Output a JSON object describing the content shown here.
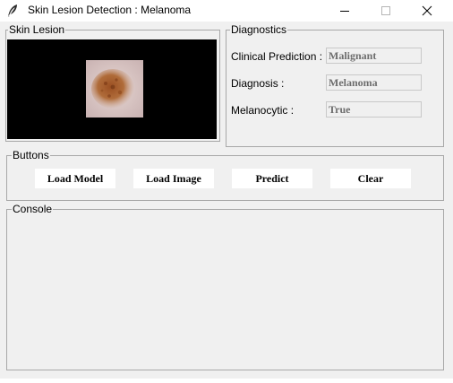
{
  "window": {
    "title": "Skin Lesion Detection : Melanoma",
    "icons": {
      "app": "feather-icon",
      "minimize": "minimize-icon",
      "maximize": "maximize-icon",
      "close": "close-icon"
    }
  },
  "skin_lesion": {
    "legend": "Skin Lesion",
    "image_icon": "skin-lesion-photo"
  },
  "diagnostics": {
    "legend": "Diagnostics",
    "fields": [
      {
        "label": "Clinical Prediction :",
        "value": "Malignant"
      },
      {
        "label": "Diagnosis :",
        "value": "Melanoma"
      },
      {
        "label": "Melanocytic :",
        "value": "True"
      }
    ]
  },
  "buttons": {
    "legend": "Buttons",
    "items": [
      {
        "label": "Load Model"
      },
      {
        "label": "Load Image"
      },
      {
        "label": "Predict"
      },
      {
        "label": "Clear"
      }
    ]
  },
  "console": {
    "legend": "Console",
    "text": ""
  },
  "colors": {
    "window_bg": "#f0f0f0",
    "canvas_bg": "#000000",
    "field_text": "#6d6d6d",
    "group_border": "#a8a8a8"
  }
}
